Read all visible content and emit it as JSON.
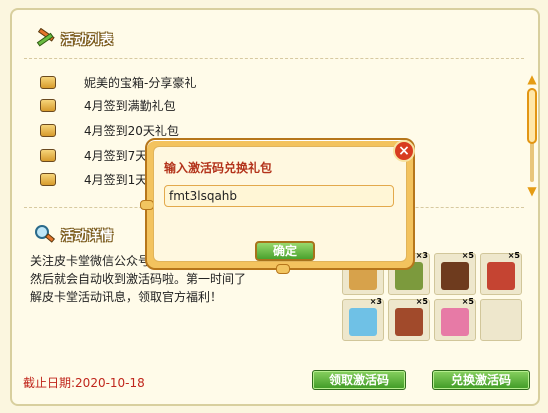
{
  "sections": {
    "activity_list_title": "活动列表",
    "activity_detail_title": "活动详情"
  },
  "activities": [
    {
      "label": "妮美的宝箱-分享豪礼",
      "icon": "gift-box-icon"
    },
    {
      "label": "4月签到满勤礼包",
      "icon": "calendar-icon"
    },
    {
      "label": "4月签到20天礼包",
      "icon": "gift-box-icon"
    },
    {
      "label": "4月签到7天礼包",
      "icon": "gift-box-icon"
    },
    {
      "label": "4月签到1天礼包",
      "icon": "gift-box-icon"
    }
  ],
  "description": "关注皮卡堂微信公众号，\n然后就会自动收到激活码啦。第一时间了\n解皮卡堂活动讯息，领取官方福利！",
  "rewards": [
    {
      "name": "item-1",
      "count": "",
      "color": "#d7a24b"
    },
    {
      "name": "item-2",
      "count": "×3",
      "color": "#7c9a3d"
    },
    {
      "name": "item-3",
      "count": "×5",
      "color": "#6e3b1e"
    },
    {
      "name": "item-4",
      "count": "×5",
      "color": "#c54432"
    },
    {
      "name": "item-5",
      "count": "×3",
      "color": "#6fc1e6"
    },
    {
      "name": "item-6",
      "count": "×5",
      "color": "#a14a2b"
    },
    {
      "name": "item-7",
      "count": "×5",
      "color": "#e77aa6"
    },
    {
      "name": "item-8",
      "count": "",
      "color": ""
    }
  ],
  "deadline": "截止日期:2020-10-18",
  "buttons": {
    "claim": "领取激活码",
    "redeem": "兑换激活码"
  },
  "dialog": {
    "title": "输入激活码兑换礼包",
    "input_value": "fmt3lsqahb",
    "ok": "确定"
  },
  "colors": {
    "accent_orange": "#e59c14",
    "button_green": "#4aa22e",
    "deadline_red": "#c0261c"
  }
}
